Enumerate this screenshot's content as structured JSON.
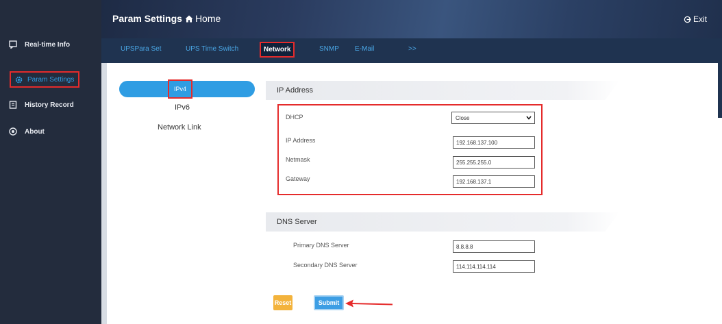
{
  "sidebar": {
    "items": [
      {
        "label": "Real-time Info",
        "icon": "chat-icon"
      },
      {
        "label": "Param Settings",
        "icon": "gear-icon",
        "active": true
      },
      {
        "label": "History Record",
        "icon": "history-icon"
      },
      {
        "label": "About",
        "icon": "info-icon"
      }
    ]
  },
  "header": {
    "title": "Param Settings",
    "home_label": "Home",
    "exit_label": "Exit"
  },
  "tabs": [
    {
      "label": "UPSPara Set"
    },
    {
      "label": "UPS Time Switch"
    },
    {
      "label": "Network",
      "active": true
    },
    {
      "label": "SNMP"
    },
    {
      "label": "E-Mail"
    },
    {
      "label": ">>"
    }
  ],
  "subnav": {
    "items": [
      {
        "label": "IPv4",
        "active": true
      },
      {
        "label": "IPv6"
      },
      {
        "label": "Network Link"
      }
    ]
  },
  "ip_section": {
    "heading": "IP Address",
    "dhcp_label": "DHCP",
    "dhcp_value": "Close",
    "ip_label": "IP Address",
    "ip_value": "192.168.137.100",
    "netmask_label": "Netmask",
    "netmask_value": "255.255.255.0",
    "gateway_label": "Gateway",
    "gateway_value": "192.168.137.1"
  },
  "dns_section": {
    "heading": "DNS Server",
    "primary_label": "Primary DNS Server",
    "primary_value": "8.8.8.8",
    "secondary_label": "Secondary DNS Server",
    "secondary_value": "114.114.114.114"
  },
  "actions": {
    "reset_label": "Reset",
    "submit_label": "Submit"
  },
  "colors": {
    "sidebar_bg": "#232c3d",
    "accent": "#2f9de3",
    "highlight_box": "#e52b2b",
    "reset": "#f3b33c"
  }
}
